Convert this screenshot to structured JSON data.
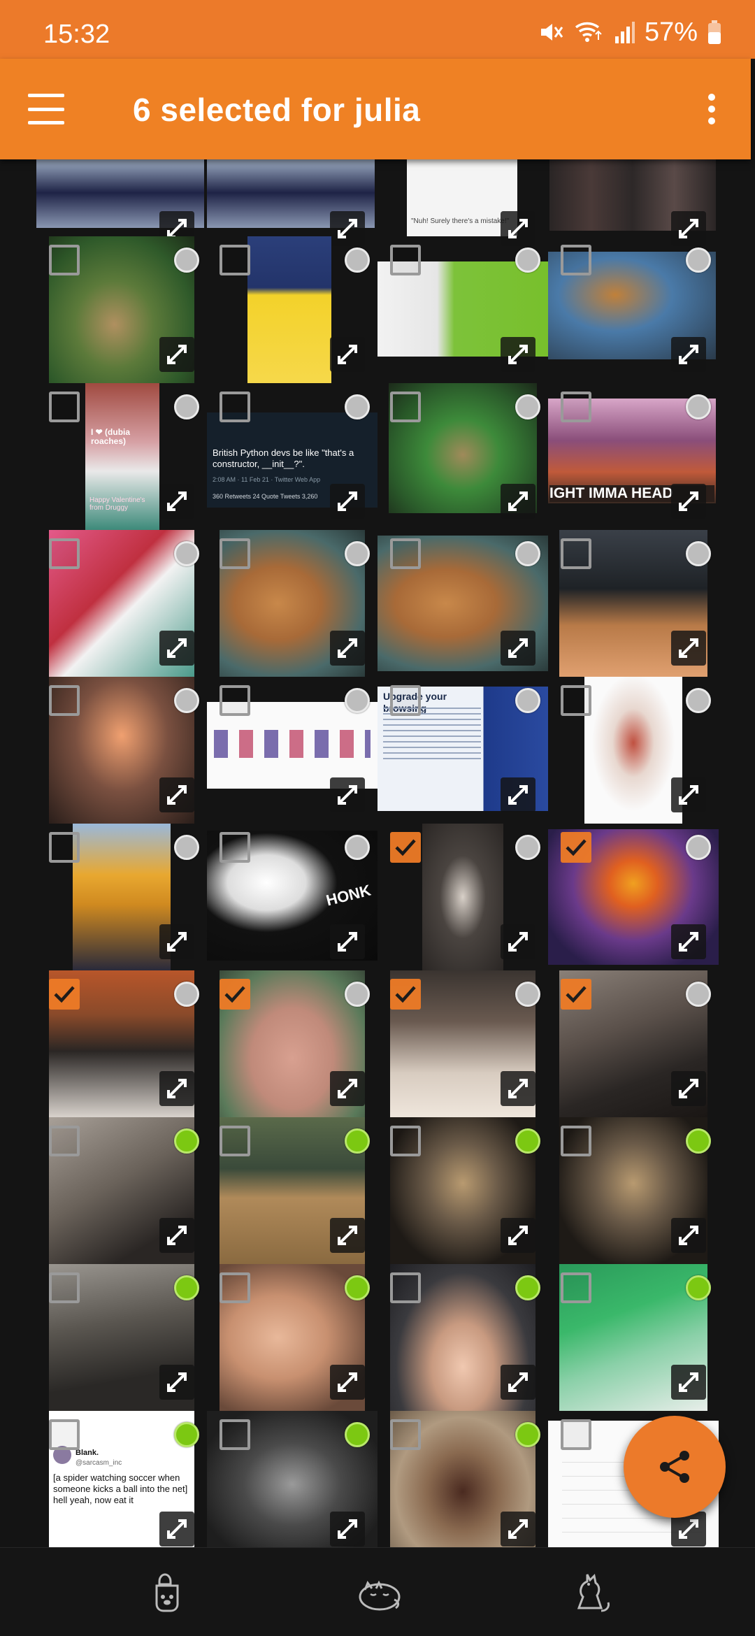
{
  "status_bar": {
    "time": "15:32",
    "battery": "57%",
    "icons": [
      "mute-icon",
      "wifi-icon",
      "signal-icon",
      "battery-icon"
    ]
  },
  "app_bar": {
    "title": "6 selected for julia",
    "menu_icon": "hamburger-icon",
    "overflow_icon": "more-vert-icon"
  },
  "thumb_text": {
    "valentine": "I ❤ (dubia roaches)",
    "valentine_sub": "Happy Valentine's from Druggy",
    "tweet_body": "British Python devs be like \"that's a constructor, __init__?\".",
    "tweet_meta": "2:08 AM · 11 Feb 21 · Twitter Web App",
    "tweet_stats": "360 Retweets  24 Quote Tweets  3,260",
    "spongebob": "IGHT IMMA HEAD",
    "browser_title": "Upgrade your browsing",
    "honk": "HONK",
    "comic_caption": "\"Nuh! Surely there's a mistake!\"",
    "spider_tweet_name": "Blank.",
    "spider_tweet_handle": "@sarcasm_inc",
    "spider_tweet_body": "[a spider watching soccer when someone kicks a ball into the net] hell yeah, now eat it"
  },
  "selection": {
    "selected_count": 6,
    "selected_items": [
      "row5-col2",
      "row5-col3",
      "row6-col0",
      "row6-col1",
      "row6-col2",
      "row6-col3"
    ]
  },
  "fab": {
    "icon": "share-icon"
  },
  "bottom_nav": {
    "items": [
      {
        "icon": "paw-icon"
      },
      {
        "icon": "sleeping-cat-icon"
      },
      {
        "icon": "sitting-cat-icon"
      }
    ]
  },
  "colors": {
    "accent": "#ef8124",
    "status_bar": "#ec7a2a",
    "background": "#141414",
    "online_dot": "#7cc812",
    "offline_dot": "#bdbdbd"
  }
}
